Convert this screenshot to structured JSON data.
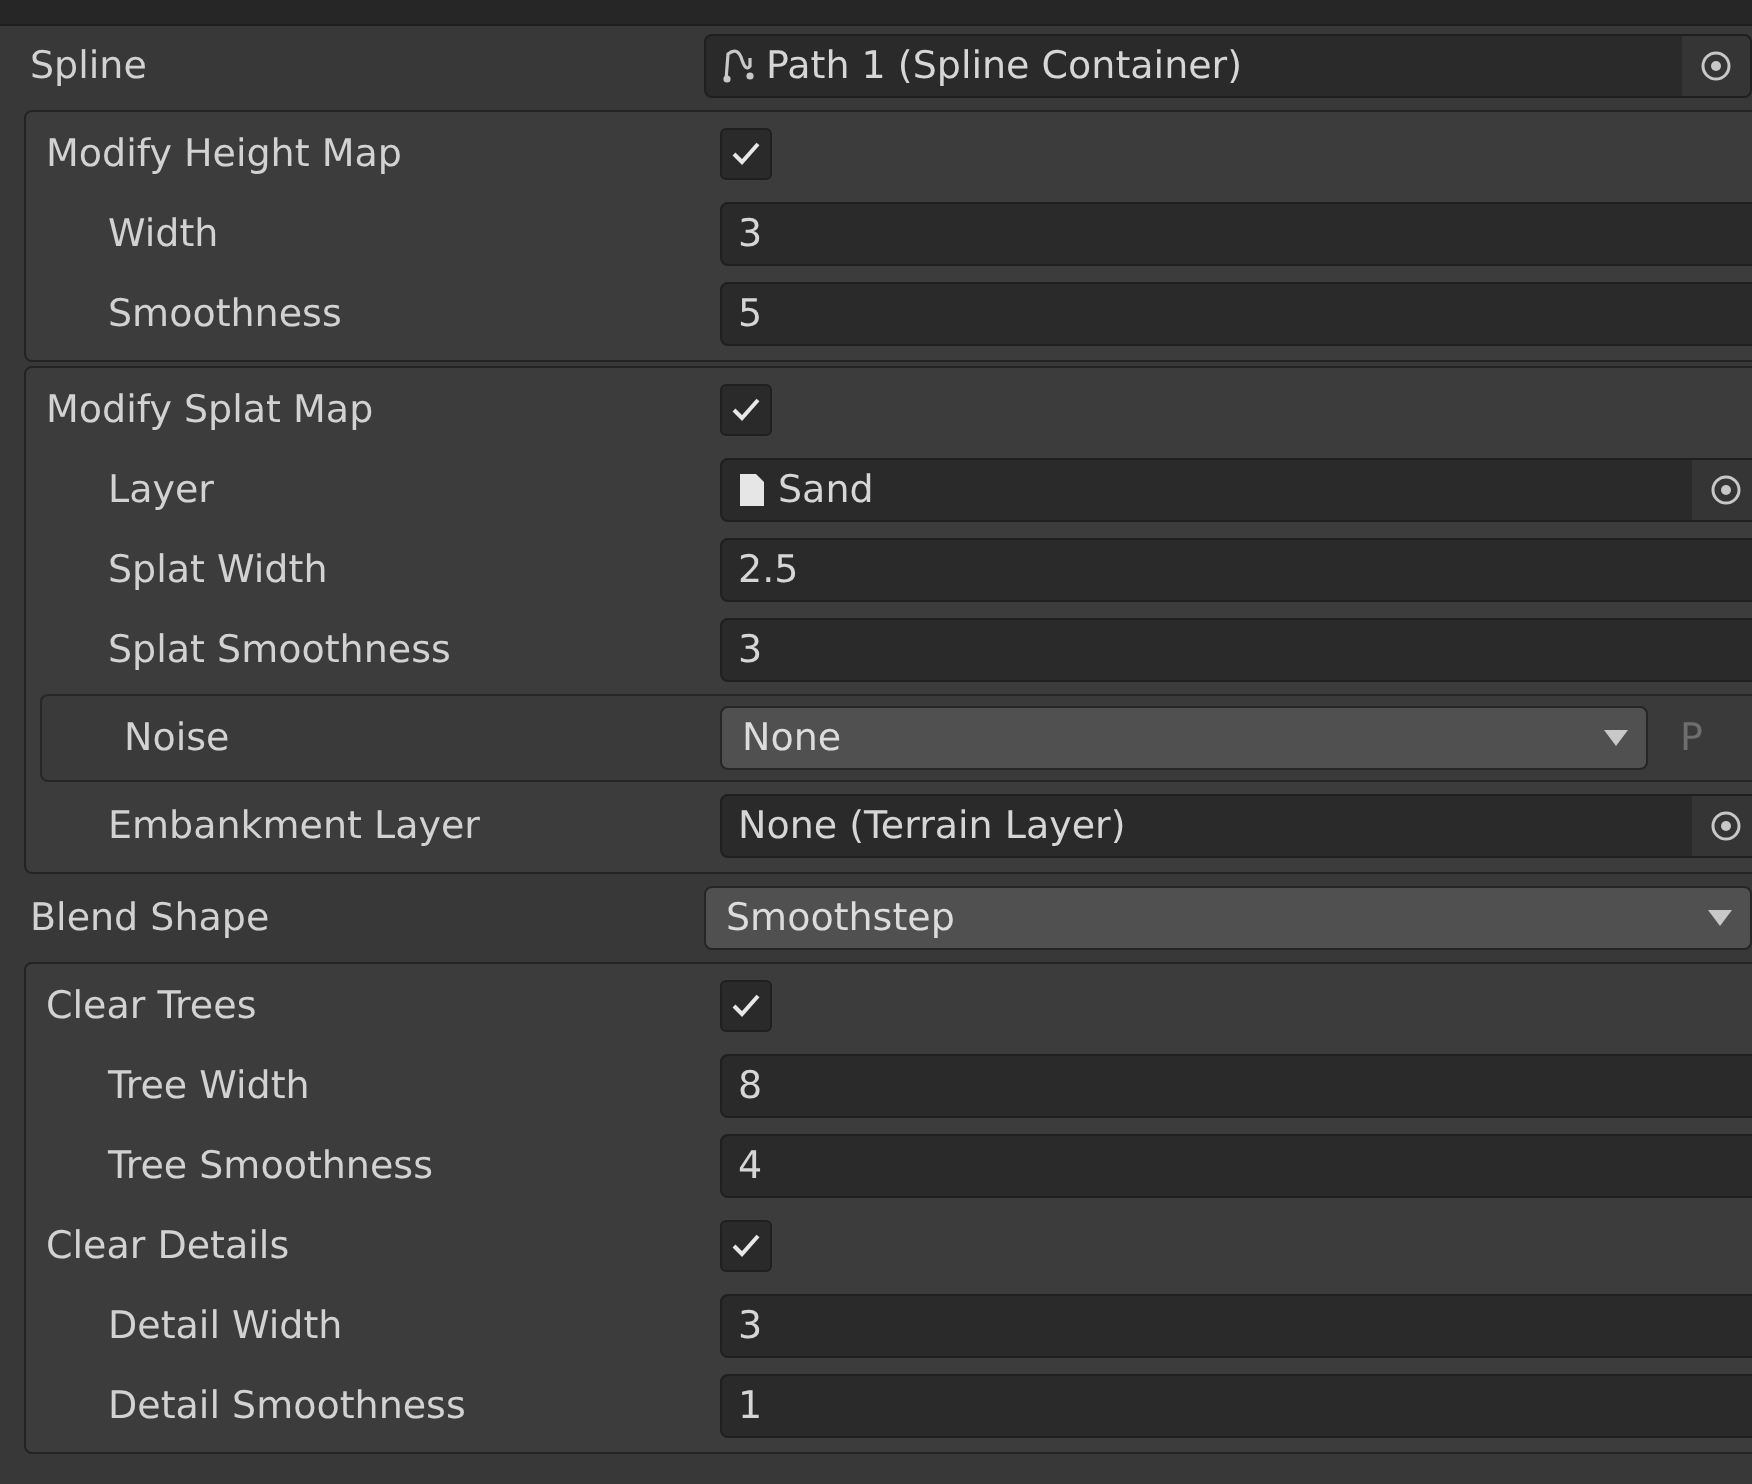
{
  "rows": [
    {
      "kind": "spline-object",
      "label": "Spline",
      "value": "Path 1 (Spline Container)"
    },
    {
      "kind": "group",
      "rows": [
        {
          "kind": "toggle",
          "label": "Modify Height Map",
          "checked": true
        },
        {
          "kind": "number",
          "label": "Width",
          "value": "3"
        },
        {
          "kind": "number",
          "label": "Smoothness",
          "value": "5"
        }
      ]
    },
    {
      "kind": "group",
      "rows": [
        {
          "kind": "toggle",
          "label": "Modify Splat Map",
          "checked": true
        },
        {
          "kind": "asset-object",
          "label": "Layer",
          "value": "Sand"
        },
        {
          "kind": "number",
          "label": "Splat Width",
          "value": "2.5"
        },
        {
          "kind": "number",
          "label": "Splat Smoothness",
          "value": "3"
        },
        {
          "kind": "framed-dropdown",
          "label": "Noise",
          "value": "None",
          "suffix": "P"
        },
        {
          "kind": "object",
          "label": "Embankment Layer",
          "value": "None (Terrain Layer)"
        }
      ]
    },
    {
      "kind": "dropdown",
      "label": "Blend Shape",
      "value": "Smoothstep"
    },
    {
      "kind": "group",
      "rows": [
        {
          "kind": "toggle",
          "label": "Clear Trees",
          "checked": true
        },
        {
          "kind": "number",
          "label": "Tree Width",
          "value": "8"
        },
        {
          "kind": "number",
          "label": "Tree Smoothness",
          "value": "4"
        },
        {
          "kind": "toggle",
          "label": "Clear Details",
          "checked": true
        },
        {
          "kind": "number",
          "label": "Detail Width",
          "value": "3"
        },
        {
          "kind": "number",
          "label": "Detail Smoothness",
          "value": "1"
        }
      ]
    }
  ]
}
